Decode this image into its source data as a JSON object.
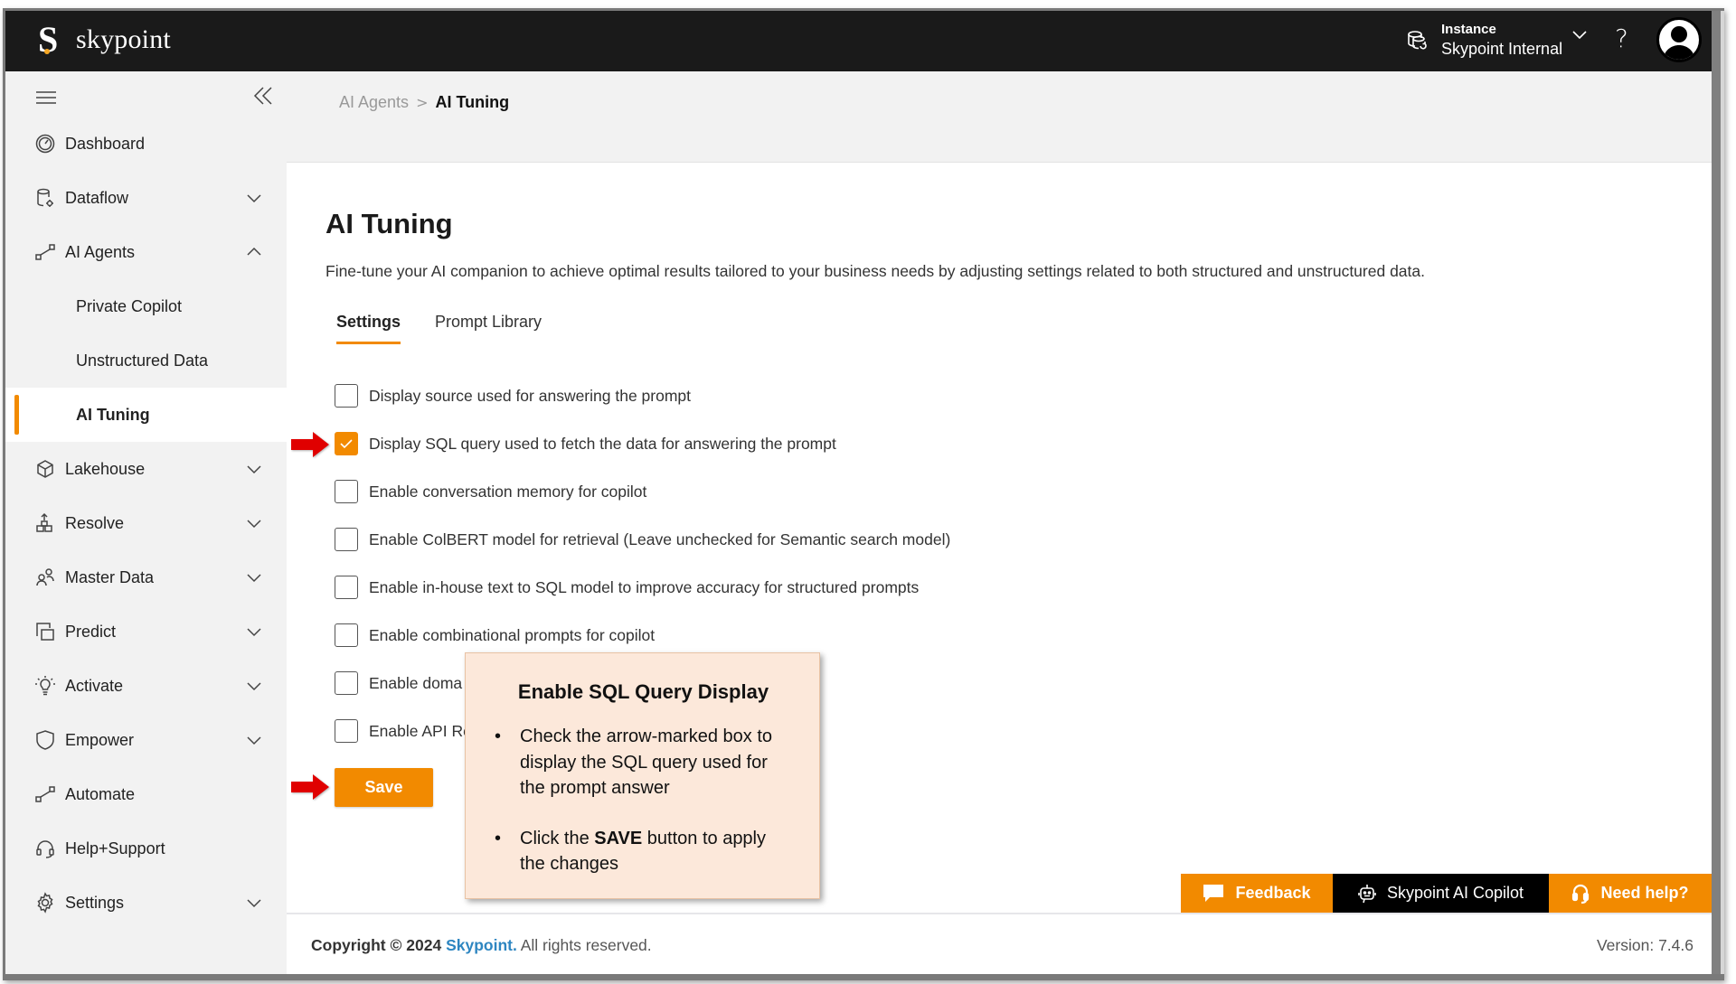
{
  "header": {
    "brand": "skypoint",
    "instance_label": "Instance",
    "instance_value": "Skypoint Internal",
    "help_glyph": "?",
    "icons": [
      "instance-database-icon",
      "chevron-down-icon",
      "help-icon",
      "user-avatar-icon"
    ]
  },
  "sidebar": {
    "items": [
      {
        "label": "Dashboard",
        "icon": "dashboard-gauge-icon",
        "chevron": null
      },
      {
        "label": "Dataflow",
        "icon": "dataflow-icon",
        "chevron": "down"
      },
      {
        "label": "AI Agents",
        "icon": "ai-agents-icon",
        "chevron": "up"
      },
      {
        "label": "Private Copilot",
        "sub": true
      },
      {
        "label": "Unstructured Data",
        "sub": true
      },
      {
        "label": "AI Tuning",
        "sub": true,
        "active": true
      },
      {
        "label": "Lakehouse",
        "icon": "cube-icon",
        "chevron": "down"
      },
      {
        "label": "Resolve",
        "icon": "resolve-icon",
        "chevron": "down"
      },
      {
        "label": "Master Data",
        "icon": "users-icon",
        "chevron": "down"
      },
      {
        "label": "Predict",
        "icon": "predict-icon",
        "chevron": "down"
      },
      {
        "label": "Activate",
        "icon": "lightbulb-icon",
        "chevron": "down"
      },
      {
        "label": "Empower",
        "icon": "shield-icon",
        "chevron": "down"
      },
      {
        "label": "Automate",
        "icon": "automate-icon",
        "chevron": null
      },
      {
        "label": "Help+Support",
        "icon": "headset-icon",
        "chevron": null
      },
      {
        "label": "Settings",
        "icon": "gear-icon",
        "chevron": "down"
      }
    ]
  },
  "breadcrumb": {
    "parent": "AI Agents",
    "separator": ">",
    "current": "AI Tuning"
  },
  "main": {
    "title": "AI Tuning",
    "description": "Fine-tune your AI companion to achieve optimal results tailored to your business needs by adjusting settings related to both structured and unstructured data.",
    "tabs": [
      {
        "label": "Settings",
        "active": true
      },
      {
        "label": "Prompt Library",
        "active": false
      }
    ],
    "options": [
      {
        "label": "Display source used for answering the prompt",
        "checked": false
      },
      {
        "label": "Display SQL query used to fetch the data for answering the prompt",
        "checked": true
      },
      {
        "label": "Enable conversation memory for copilot",
        "checked": false
      },
      {
        "label": "Enable ColBERT model for retrieval (Leave unchecked for Semantic search model)",
        "checked": false
      },
      {
        "label": "Enable in-house text to SQL model to improve accuracy for structured prompts",
        "checked": false
      },
      {
        "label": "Enable combinational prompts for copilot",
        "checked": false
      },
      {
        "label": "Enable doma",
        "checked": false
      },
      {
        "label": "Enable API Re",
        "checked": false
      }
    ],
    "save_label": "Save"
  },
  "annotation": {
    "title": "Enable SQL Query Display",
    "bullets": [
      {
        "pre": "Check the arrow-marked box to display the SQL query used for the prompt answer",
        "bold": "",
        "post": ""
      },
      {
        "pre": "Click the ",
        "bold": "SAVE",
        "post": " button to apply the changes"
      }
    ],
    "arrow_color": "#e00000"
  },
  "floating_buttons": {
    "feedback": "Feedback",
    "copilot": "Skypoint AI Copilot",
    "need_help": "Need help?"
  },
  "footer": {
    "copyright_prefix": "Copyright © 2024",
    "brand": "Skypoint.",
    "copyright_suffix": "All rights reserved.",
    "version": "Version: 7.4.6"
  },
  "colors": {
    "accent": "#f28a00",
    "header_bg": "#1a1a1a",
    "sidebar_bg": "#f2f2f2",
    "link": "#2e86c1",
    "annotation_bg": "#fce8da"
  }
}
